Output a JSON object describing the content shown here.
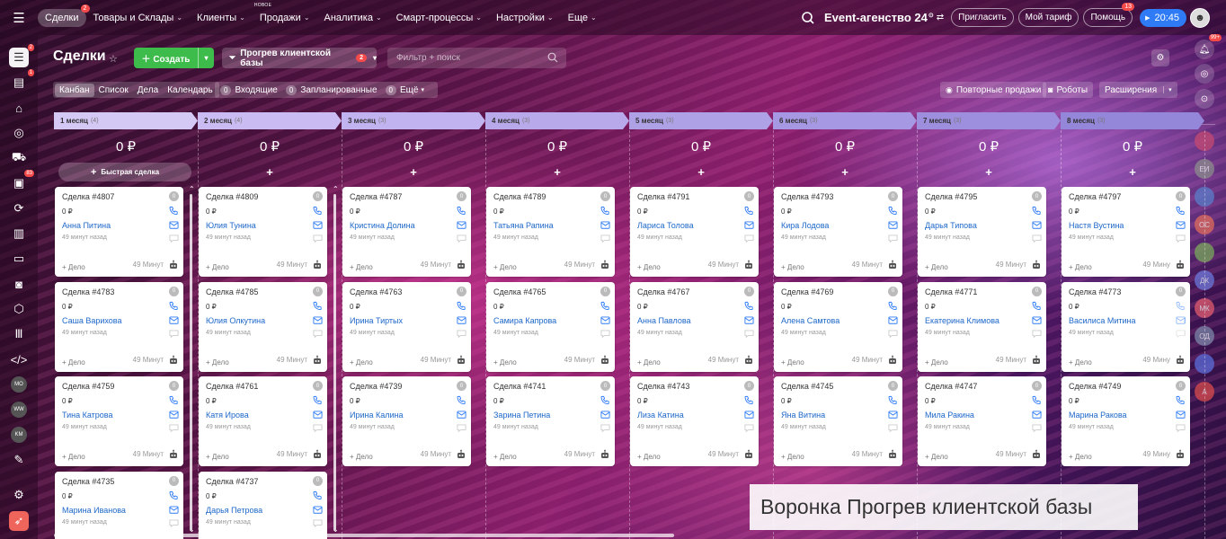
{
  "topbar": {
    "nav": [
      {
        "label": "Сделки",
        "badge": "2",
        "active": true,
        "chevron": false,
        "new": ""
      },
      {
        "label": "Товары и Склады",
        "badge": "",
        "active": false,
        "chevron": true,
        "new": ""
      },
      {
        "label": "Клиенты",
        "badge": "",
        "active": false,
        "chevron": true,
        "new": ""
      },
      {
        "label": "Продажи",
        "badge": "",
        "active": false,
        "chevron": true,
        "new": "НОВОЕ"
      },
      {
        "label": "Аналитика",
        "badge": "",
        "active": false,
        "chevron": true,
        "new": ""
      },
      {
        "label": "Смарт-процессы",
        "badge": "",
        "active": false,
        "chevron": true,
        "new": ""
      },
      {
        "label": "Настройки",
        "badge": "",
        "active": false,
        "chevron": true,
        "new": ""
      },
      {
        "label": "Еще",
        "badge": "",
        "active": false,
        "chevron": true,
        "new": ""
      }
    ],
    "company": "Event-агенство 24",
    "company_sup": "⊙",
    "invite": "Пригласить",
    "tariff": "Мой тариф",
    "help": "Помощь",
    "help_badge": "13",
    "timer": "20:45"
  },
  "leftbar": {
    "deals_badge": "2",
    "tasks_badge": "1",
    "feed_badge": "83",
    "avatars": [
      "MO",
      "WW",
      "KM"
    ]
  },
  "rightbar": {
    "bell_badge": "99+",
    "avatars": [
      {
        "initials": "",
        "color": "#c44a72"
      },
      {
        "initials": "ЕИ",
        "color": "#8d8d8d"
      },
      {
        "initials": "",
        "color": "#5b7ec9"
      },
      {
        "initials": "ОС",
        "color": "#e06c5c"
      },
      {
        "initials": "",
        "color": "#7aa85c"
      },
      {
        "initials": "ДК",
        "color": "#6c78d9"
      },
      {
        "initials": "МК",
        "color": "#e05c6e"
      },
      {
        "initials": "ОД",
        "color": "#7c86a8"
      },
      {
        "initials": "",
        "color": "#5c6ed9"
      },
      {
        "initials": "А",
        "color": "#d94c4c"
      }
    ]
  },
  "header": {
    "title": "Сделки",
    "create_label": "Создать",
    "funnel_label": "Прогрев клиентской базы",
    "funnel_badge": "2",
    "filter_placeholder": "Фильтр + поиск"
  },
  "toolbar": {
    "views": [
      "Канбан",
      "Список",
      "Дела",
      "Календарь"
    ],
    "incoming_count": "0",
    "incoming_label": "Входящие",
    "planned_count": "0",
    "planned_label": "Запланированные",
    "more_count": "0",
    "more_label": "Ещё",
    "repeat_sales": "Повторные продажи",
    "robots": "Роботы",
    "extensions": "Расширения"
  },
  "quick_deal": "Быстрая сделка",
  "columns": [
    {
      "label": "1 месяц",
      "count": "(4)",
      "sum": "0 ₽",
      "color": "#d4c8f5",
      "cards": [
        {
          "title": "Сделка #4807",
          "amount": "0 ₽",
          "contact": "Анна Питина",
          "time": "49 минут назад",
          "add": "+ Дело",
          "mins": "49 Минут"
        },
        {
          "title": "Сделка #4783",
          "amount": "0 ₽",
          "contact": "Саша Варихова",
          "time": "49 минут назад",
          "add": "+ Дело",
          "mins": "49 Минут"
        },
        {
          "title": "Сделка #4759",
          "amount": "0 ₽",
          "contact": "Тина Катрова",
          "time": "49 минут назад",
          "add": "+ Дело",
          "mins": "49 Минут"
        },
        {
          "title": "Сделка #4735",
          "amount": "0 ₽",
          "contact": "Марина Иванова",
          "time": "49 минут назад",
          "add": "",
          "mins": ""
        }
      ]
    },
    {
      "label": "2 месяц",
      "count": "(4)",
      "sum": "0 ₽",
      "color": "#cabcf2",
      "cards": [
        {
          "title": "Сделка #4809",
          "amount": "0 ₽",
          "contact": "Юлия Тунина",
          "time": "49 минут назад",
          "add": "+ Дело",
          "mins": "49 Минут"
        },
        {
          "title": "Сделка #4785",
          "amount": "0 ₽",
          "contact": "Юлия Олкутина",
          "time": "49 минут назад",
          "add": "+ Дело",
          "mins": "49 Минут"
        },
        {
          "title": "Сделка #4761",
          "amount": "0 ₽",
          "contact": "Катя Ирова",
          "time": "49 минут назад",
          "add": "+ Дело",
          "mins": "49 Минут"
        },
        {
          "title": "Сделка #4737",
          "amount": "0 ₽",
          "contact": "Дарья Петрова",
          "time": "49 минут назад",
          "add": "",
          "mins": ""
        }
      ]
    },
    {
      "label": "3 месяц",
      "count": "(3)",
      "sum": "0 ₽",
      "color": "#c1b3ef",
      "cards": [
        {
          "title": "Сделка #4787",
          "amount": "0 ₽",
          "contact": "Кристина Долина",
          "time": "49 минут назад",
          "add": "+ Дело",
          "mins": "49 Минут"
        },
        {
          "title": "Сделка #4763",
          "amount": "0 ₽",
          "contact": "Ирина Тиртых",
          "time": "49 минут назад",
          "add": "+ Дело",
          "mins": "49 Минут"
        },
        {
          "title": "Сделка #4739",
          "amount": "0 ₽",
          "contact": "Ирина Калина",
          "time": "49 минут назад",
          "add": "+ Дело",
          "mins": "49 Минут"
        }
      ]
    },
    {
      "label": "4 месяц",
      "count": "(3)",
      "sum": "0 ₽",
      "color": "#b8aaea",
      "cards": [
        {
          "title": "Сделка #4789",
          "amount": "0 ₽",
          "contact": "Татьяна Рапина",
          "time": "49 минут назад",
          "add": "+ Дело",
          "mins": "49 Минут"
        },
        {
          "title": "Сделка #4765",
          "amount": "0 ₽",
          "contact": "Самира Капрова",
          "time": "49 минут назад",
          "add": "+ Дело",
          "mins": "49 Минут"
        },
        {
          "title": "Сделка #4741",
          "amount": "0 ₽",
          "contact": "Зарина Петина",
          "time": "49 минут назад",
          "add": "+ Дело",
          "mins": "49 Минут"
        }
      ]
    },
    {
      "label": "5 месяц",
      "count": "(3)",
      "sum": "0 ₽",
      "color": "#afa1e6",
      "cards": [
        {
          "title": "Сделка #4791",
          "amount": "0 ₽",
          "contact": "Лариса Толова",
          "time": "49 минут назад",
          "add": "+ Дело",
          "mins": "49 Минут"
        },
        {
          "title": "Сделка #4767",
          "amount": "0 ₽",
          "contact": "Анна Павлова",
          "time": "49 минут назад",
          "add": "+ Дело",
          "mins": "49 Минут"
        },
        {
          "title": "Сделка #4743",
          "amount": "0 ₽",
          "contact": "Лиза Катина",
          "time": "49 минут назад",
          "add": "+ Дело",
          "mins": "49 Минут"
        }
      ]
    },
    {
      "label": "6 месяц",
      "count": "(3)",
      "sum": "0 ₽",
      "color": "#a698e2",
      "cards": [
        {
          "title": "Сделка #4793",
          "amount": "0 ₽",
          "contact": "Кира Лодова",
          "time": "49 минут назад",
          "add": "+ Дело",
          "mins": "49 Минут"
        },
        {
          "title": "Сделка #4769",
          "amount": "0 ₽",
          "contact": "Алена Самтова",
          "time": "49 минут назад",
          "add": "+ Дело",
          "mins": "49 Минут"
        },
        {
          "title": "Сделка #4745",
          "amount": "0 ₽",
          "contact": "Яна Витина",
          "time": "49 минут назад",
          "add": "+ Дело",
          "mins": "49 Минут"
        }
      ]
    },
    {
      "label": "7 месяц",
      "count": "(3)",
      "sum": "0 ₽",
      "color": "#9d8fdd",
      "cards": [
        {
          "title": "Сделка #4795",
          "amount": "0 ₽",
          "contact": "Дарья Типова",
          "time": "49 минут назад",
          "add": "+ Дело",
          "mins": "49 Минут"
        },
        {
          "title": "Сделка #4771",
          "amount": "0 ₽",
          "contact": "Екатерина Климова",
          "time": "49 минут назад",
          "add": "+ Дело",
          "mins": "49 Минут"
        },
        {
          "title": "Сделка #4747",
          "amount": "0 ₽",
          "contact": "Мила Ракина",
          "time": "49 минут назад",
          "add": "+ Дело",
          "mins": "49 Минут"
        }
      ]
    },
    {
      "label": "8 месяц",
      "count": "(3)",
      "sum": "0 ₽",
      "color": "#9486d9",
      "cards": [
        {
          "title": "Сделка #4797",
          "amount": "0 ₽",
          "contact": "Настя Вустина",
          "time": "49 минут назад",
          "add": "+ Дело",
          "mins": "49 Мину"
        },
        {
          "title": "Сделка #4773",
          "amount": "0 ₽",
          "contact": "Василиса Митина",
          "time": "49 минут назад",
          "add": "+ Дело",
          "mins": "49 Мину"
        },
        {
          "title": "Сделка #4749",
          "amount": "0 ₽",
          "contact": "Марина Ракова",
          "time": "49 минут назад",
          "add": "+ Дело",
          "mins": "49 Мину"
        }
      ]
    }
  ],
  "caption": "Воронка Прогрев клиентской базы"
}
